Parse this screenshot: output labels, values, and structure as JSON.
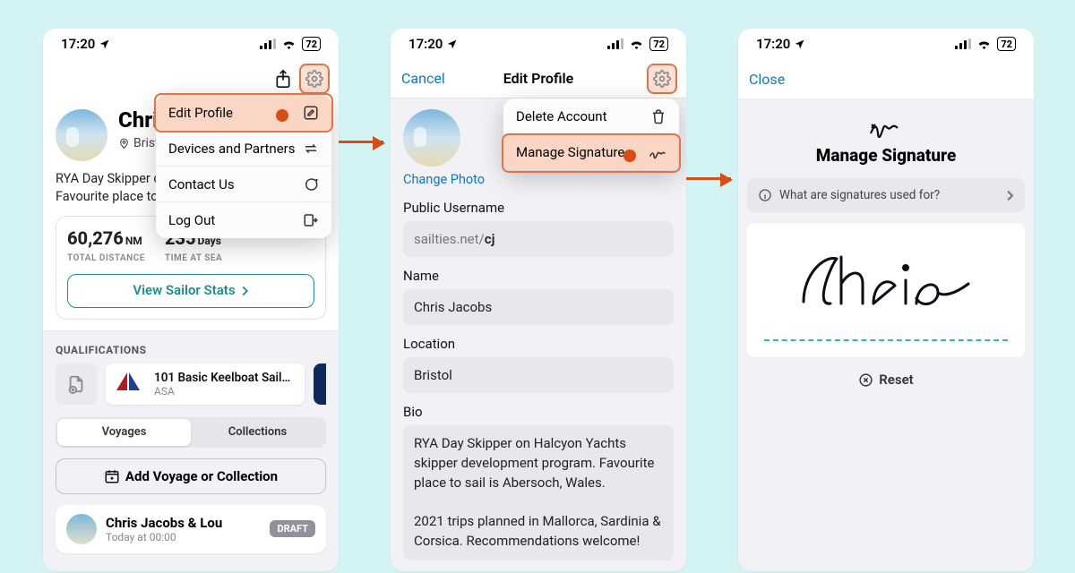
{
  "statusbar": {
    "time": "17:20",
    "battery": "72"
  },
  "screen1": {
    "name_visible": "Chris",
    "location": "Bristol",
    "bio_trunc": "RYA Day Skipper on development progra Favourite place to sa",
    "stats": {
      "distance_val": "60,276",
      "distance_unit": "NM",
      "distance_lbl": "TOTAL DISTANCE",
      "days_val": "235",
      "days_unit": "Days",
      "days_lbl": "TIME AT SEA"
    },
    "view_stats": "View Sailor Stats",
    "qual_header": "QUALIFICATIONS",
    "qual_title": "101 Basic Keelboat Sail…",
    "qual_org": "ASA",
    "seg": {
      "voyages": "Voyages",
      "collections": "Collections"
    },
    "add_voyage": "Add Voyage or Collection",
    "voyage": {
      "title": "Chris Jacobs & Lou",
      "subtitle": "Today at 00:00",
      "badge": "DRAFT"
    },
    "menu": {
      "edit": "Edit Profile",
      "devices": "Devices and Partners",
      "contact": "Contact Us",
      "logout": "Log Out"
    }
  },
  "screen2": {
    "nav": {
      "cancel": "Cancel",
      "title": "Edit Profile"
    },
    "change_photo": "Change Photo",
    "username_lbl": "Public Username",
    "username_prefix": "sailties.net/",
    "username_val": "cj",
    "name_lbl": "Name",
    "name_val": "Chris Jacobs",
    "loc_lbl": "Location",
    "loc_val": "Bristol",
    "bio_lbl": "Bio",
    "bio_val": "RYA Day Skipper on Halcyon Yachts skipper development program. Favourite place to sail is Abersoch, Wales.\n\n2021 trips planned in Mallorca, Sardinia & Corsica. Recommendations welcome!",
    "menu": {
      "delete": "Delete Account",
      "signature": "Manage Signature"
    }
  },
  "screen3": {
    "nav": {
      "close": "Close"
    },
    "title": "Manage Signature",
    "info": "What are signatures used for?",
    "reset": "Reset"
  }
}
